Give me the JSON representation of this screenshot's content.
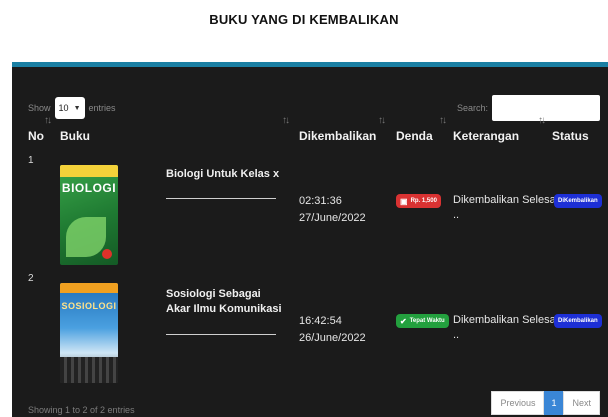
{
  "page": {
    "title": "BUKU YANG DI KEMBALIKAN"
  },
  "colors": {
    "accent": "#1a7fa3",
    "panel": "#1b1b1b",
    "badge_red": "#d93232",
    "badge_green": "#23a03e",
    "badge_blue": "#1d2fd6",
    "page_active": "#3a86d6"
  },
  "controls": {
    "show_label": "Show",
    "entries_value": "10",
    "entries_label": "entries",
    "search_label": "Search:"
  },
  "table": {
    "headers": [
      "No",
      "Buku",
      "Dikembalikan",
      "Denda",
      "Keterangan",
      "Status"
    ],
    "rows": [
      {
        "no": "1",
        "cover_text": "BIOLOGI",
        "title": "Biologi Untuk Kelas x",
        "time": "02:31:36",
        "date": "27/June/2022",
        "denda": "Rp. 1,500",
        "denda_icon": "money-icon",
        "keterangan": "Dikembalikan Selesai",
        "keterangan_extra": "..",
        "status": "DiKembalikan"
      },
      {
        "no": "2",
        "cover_text": "SOSIOLOGI",
        "title": "Sosiologi Sebagai Akar Ilmu Komunikasi",
        "time": "16:42:54",
        "date": "26/June/2022",
        "denda": "Tepat Waktu",
        "denda_icon": "check-icon",
        "keterangan": "Dikembalikan Selesai",
        "keterangan_extra": "..",
        "status": "DiKembalikan"
      }
    ]
  },
  "footer": {
    "info": "Showing 1 to 2 of 2 entries",
    "previous": "Previous",
    "current_page": "1",
    "next": "Next"
  }
}
